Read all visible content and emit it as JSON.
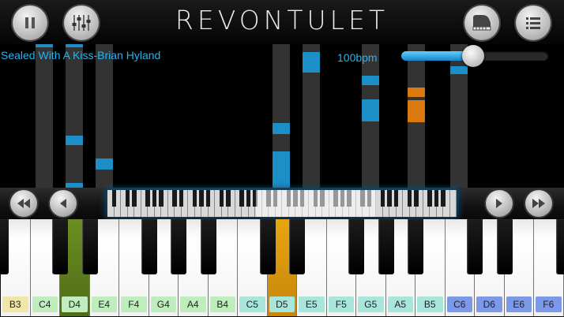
{
  "app": {
    "title": "REVONTULET"
  },
  "header": {
    "pause_icon": "pause-icon",
    "mixer_icon": "sliders-icon",
    "piano_icon": "grand-piano-icon",
    "list_icon": "list-icon"
  },
  "song": {
    "title": "Sealed With A Kiss-Brian Hyland"
  },
  "tempo": {
    "label": "100bpm",
    "slider_level": 0.49
  },
  "colors": {
    "accent": "#26b4f0",
    "note_blue": "#1b8fc6",
    "note_orange": "#d9790f",
    "key_active_green": "#5a7a1c",
    "key_active_orange": "#dc9a0c"
  },
  "navigation": {
    "rewind_icon": "double-left-icon",
    "prev_icon": "left-arrow-icon",
    "next_icon": "right-arrow-icon",
    "fast_forward_icon": "double-right-icon"
  },
  "keyboard": {
    "white_keys": [
      "B3",
      "C4",
      "D4",
      "E4",
      "F4",
      "G4",
      "A4",
      "B4",
      "C5",
      "D5",
      "E5",
      "F5",
      "G5",
      "A5",
      "B5",
      "C6",
      "D6",
      "E6",
      "F6"
    ],
    "label_colors": [
      "yellow",
      "green",
      "green",
      "green",
      "green",
      "green",
      "green",
      "green",
      "teal",
      "teal",
      "teal",
      "teal",
      "teal",
      "teal",
      "teal",
      "blue",
      "blue",
      "blue",
      "blue"
    ],
    "active_keys": [
      "D4",
      "D5"
    ]
  }
}
